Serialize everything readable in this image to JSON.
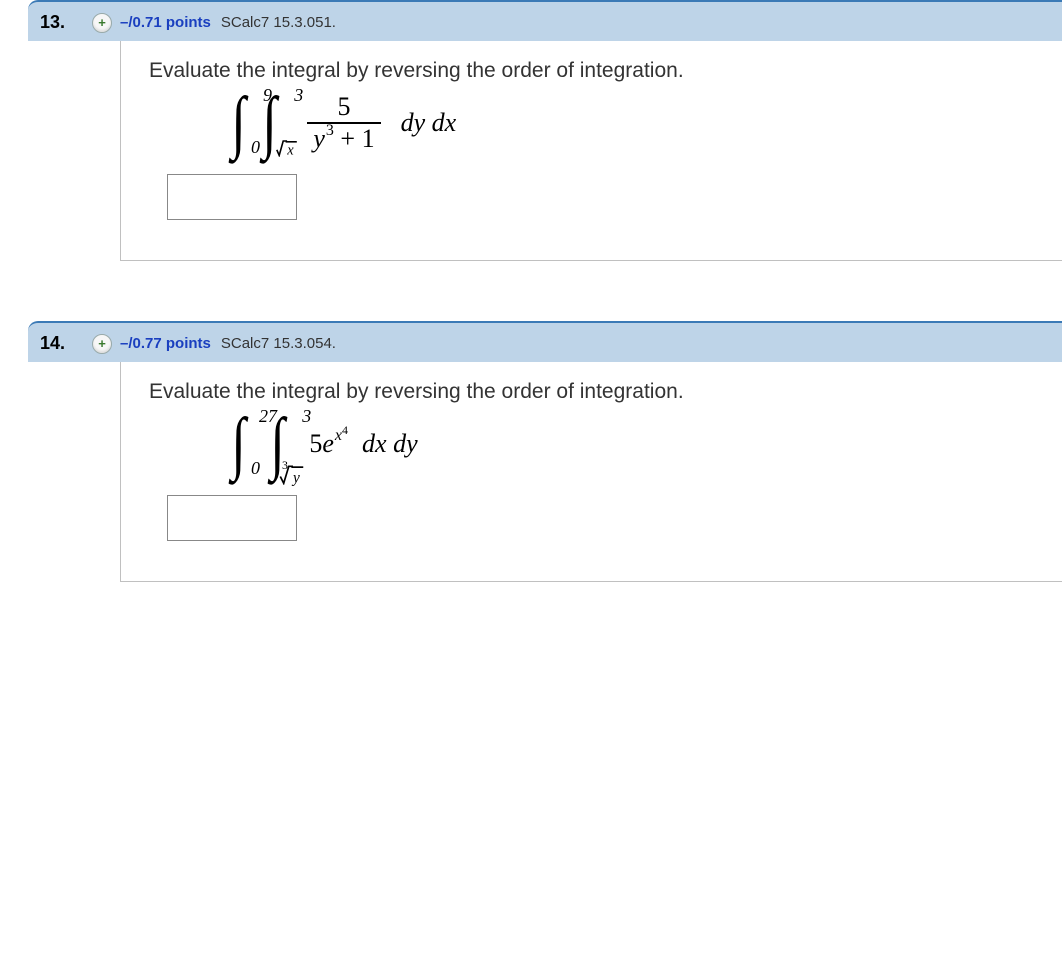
{
  "questions": [
    {
      "number": "13.",
      "points": "–/0.71 points",
      "source": "SCalc7 15.3.051.",
      "prompt": "Evaluate the integral by reversing the order of integration.",
      "outer_lower": "0",
      "outer_upper": "9",
      "inner_lower_rootindex": "",
      "inner_lower_radicand": "x",
      "inner_upper": "3",
      "frac_num": "5",
      "frac_den_base": "y",
      "frac_den_exp": "3",
      "frac_den_plus": " + 1",
      "diff": "dy dx",
      "answer": ""
    },
    {
      "number": "14.",
      "points": "–/0.77 points",
      "source": "SCalc7 15.3.054.",
      "prompt": "Evaluate the integral by reversing the order of integration.",
      "outer_lower": "0",
      "outer_upper": "27",
      "inner_lower_rootindex": "3",
      "inner_lower_radicand": "y",
      "inner_upper": "3",
      "coef": "5",
      "ebase": "e",
      "exp_base": "x",
      "exp_exp": "4",
      "diff": "dx dy",
      "answer": ""
    }
  ],
  "plus_glyph": "+"
}
